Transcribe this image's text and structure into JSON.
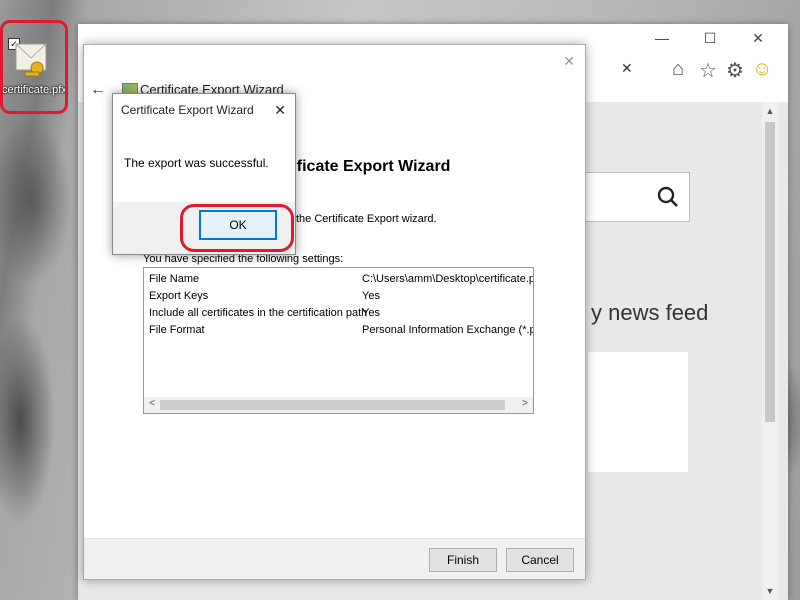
{
  "desktop": {
    "icon_label": "certificate.pfx",
    "accent_red": "#e0192e"
  },
  "browser": {
    "news_text": "y news feed",
    "icons": [
      "home-icon",
      "star-icon",
      "gear-icon",
      "smiley-icon"
    ]
  },
  "wizard": {
    "title": "Certificate Export Wizard",
    "heading": "tificate Export Wizard",
    "intro_line": "the Certificate Export wizard.",
    "settings_label": "You have specified the following settings:",
    "settings": [
      {
        "key": "File Name",
        "value": "C:\\Users\\amm\\Desktop\\certificate.pfx"
      },
      {
        "key": "Export Keys",
        "value": "Yes"
      },
      {
        "key": "Include all certificates in the certification path",
        "value": "Yes"
      },
      {
        "key": "File Format",
        "value": "Personal Information Exchange (*.pfx"
      }
    ],
    "finish_label": "Finish",
    "cancel_label": "Cancel"
  },
  "messagebox": {
    "title": "Certificate Export Wizard",
    "message": "The export was successful.",
    "ok_label": "OK"
  }
}
